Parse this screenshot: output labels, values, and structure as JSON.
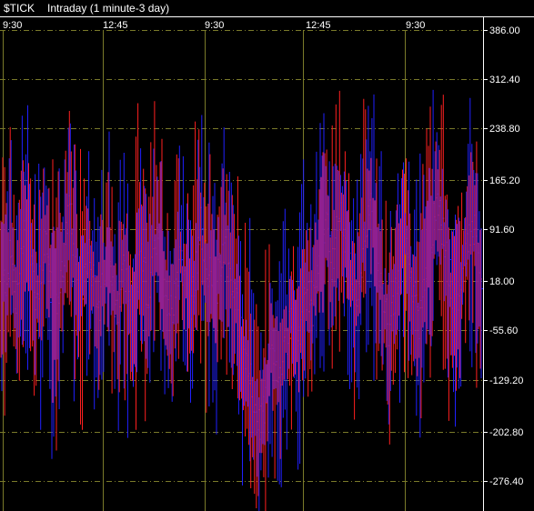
{
  "header": {
    "symbol": "$TICK",
    "description": "Intraday (1 minute-3 day)"
  },
  "colors": {
    "background": "#000000",
    "up_bar": "#ff2020",
    "down_bar": "#2020ff",
    "grid": "#7a7a2a",
    "axis_text": "#ffffff"
  },
  "chart_data": {
    "type": "line",
    "title": "$TICK",
    "subtitle": "Intraday (1 minute-3 day)",
    "x_tick_labels": [
      "9:30",
      "12:45",
      "9:30",
      "12:45",
      "9:30"
    ],
    "y_tick_labels": [
      "386.00",
      "312.40",
      "238.80",
      "165.20",
      "91.60",
      "18.00",
      "-55.60",
      "-129.20",
      "-202.80",
      "-276.40"
    ],
    "ylim": [
      -350,
      386
    ],
    "grid": true,
    "style": "vertical high-low bars, alternating red and blue",
    "series": [
      {
        "name": "",
        "approx_values": [
          10,
          20,
          60,
          -20,
          40,
          120,
          50,
          -10,
          30,
          80,
          20,
          -40,
          10,
          60,
          130,
          40,
          -20,
          30,
          70,
          10,
          -30,
          20,
          50,
          0,
          -20,
          40,
          10,
          -60,
          20,
          50,
          -10,
          30,
          80,
          40,
          0,
          -30,
          20,
          60,
          10,
          -20,
          30,
          100,
          60,
          20,
          -10,
          40,
          80,
          30,
          0,
          -40,
          -80,
          -120,
          -160,
          -200,
          -180,
          -120,
          -80,
          -140,
          -100,
          -60,
          -20,
          -80,
          -40,
          10,
          -30,
          20,
          60,
          100,
          40,
          80,
          120,
          60,
          20,
          -10,
          40,
          90,
          130,
          70,
          30,
          -20,
          -60,
          -20,
          30,
          80,
          40,
          0,
          -40,
          20,
          60,
          100,
          140,
          80,
          40,
          0,
          -30,
          20,
          70,
          110,
          60,
          20
        ]
      }
    ]
  }
}
